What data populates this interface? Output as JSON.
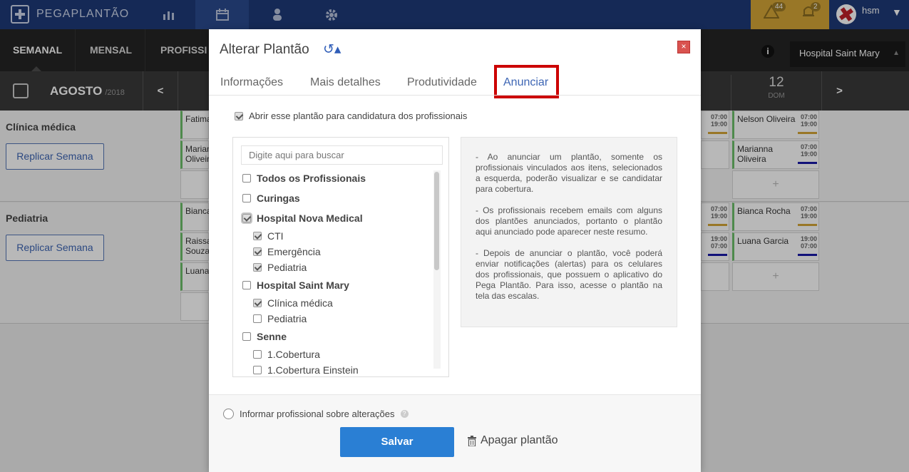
{
  "app": {
    "name": "PEGAPLANTÃO"
  },
  "alerts": {
    "warning_count": "44",
    "bell_count": "2"
  },
  "user": {
    "name": "hsm"
  },
  "view_tabs": [
    "SEMANAL",
    "MENSAL",
    "PROFISSI"
  ],
  "hospital_select": {
    "value": "Hospital Saint Mary"
  },
  "week": {
    "month": "AGOSTO",
    "year": "/2018",
    "prev": "<",
    "next": ">",
    "day_num": "12",
    "day_name": "DOM"
  },
  "sections": [
    {
      "title": "Clínica médica",
      "button": "Replicar Semana"
    },
    {
      "title": "Pediatria",
      "button": "Replicar Semana"
    }
  ],
  "left_cells": [
    "Fatima",
    "Marian\nOliveir",
    "Bianca",
    "Raissa\nSouza",
    "Luana"
  ],
  "right_cells": [
    {
      "name": "Nelson Oliveira",
      "times": "07:00\n19:00",
      "color": "#d4a536"
    },
    {
      "name": "Marianna\nOliveira",
      "times": "07:00\n19:00",
      "color": "#1a1aa8"
    },
    {
      "name": "Bianca Rocha",
      "times": "07:00\n19:00",
      "color": "#d4a536"
    },
    {
      "name": "Luana Garcia",
      "times": "19:00\n07:00",
      "color": "#1a1aa8"
    }
  ],
  "mid_times": [
    "07:00\n19:00",
    "07:00\n19:00",
    "19:00\n07:00"
  ],
  "empty_plus": "+",
  "modal": {
    "title": "Alterar Plantão",
    "history_icon": "↺▴",
    "close": "×",
    "tabs": [
      "Informações",
      "Mais detalhes",
      "Produtividade",
      "Anunciar"
    ],
    "open_checkbox": "Abrir esse plantão para candidatura dos profissionais",
    "search_placeholder": "Digite aqui para buscar",
    "list": [
      {
        "label": "Todos os Profissionais",
        "bold": true,
        "checked": false
      },
      {
        "label": "Curingas",
        "bold": true,
        "checked": false
      },
      {
        "label": "Hospital Nova Medical",
        "bold": true,
        "checked": true
      },
      {
        "label": "CTI",
        "bold": false,
        "checked": true
      },
      {
        "label": "Emergência",
        "bold": false,
        "checked": true
      },
      {
        "label": "Pediatria",
        "bold": false,
        "checked": true
      },
      {
        "label": "Hospital Saint Mary",
        "bold": true,
        "checked": false
      },
      {
        "label": "Clínica médica",
        "bold": false,
        "checked": true
      },
      {
        "label": "Pediatria",
        "bold": false,
        "checked": false
      },
      {
        "label": "Senne",
        "bold": true,
        "checked": false
      },
      {
        "label": "1.Cobertura",
        "bold": false,
        "checked": false
      },
      {
        "label": "1.Cobertura Einstein",
        "bold": false,
        "checked": false
      }
    ],
    "info": [
      "- Ao anunciar um plantão, somente os profissionais vinculados aos itens, selecionados a esquerda, poderão visualizar e se candidatar para cobertura.",
      "- Os profissionais recebem emails com alguns dos plantões anunciados, portanto o plantão aqui anunciado pode aparecer neste resumo.",
      "- Depois de anunciar o plantão, você poderá enviar notificações (alertas) para os celulares dos profissionais, que possuem o aplicativo do Pega Plantão. Para isso, acesse o plantão na tela das escalas."
    ],
    "notify_label": "Informar profissional sobre alterações",
    "save": "Salvar",
    "delete": "Apagar plantão"
  }
}
